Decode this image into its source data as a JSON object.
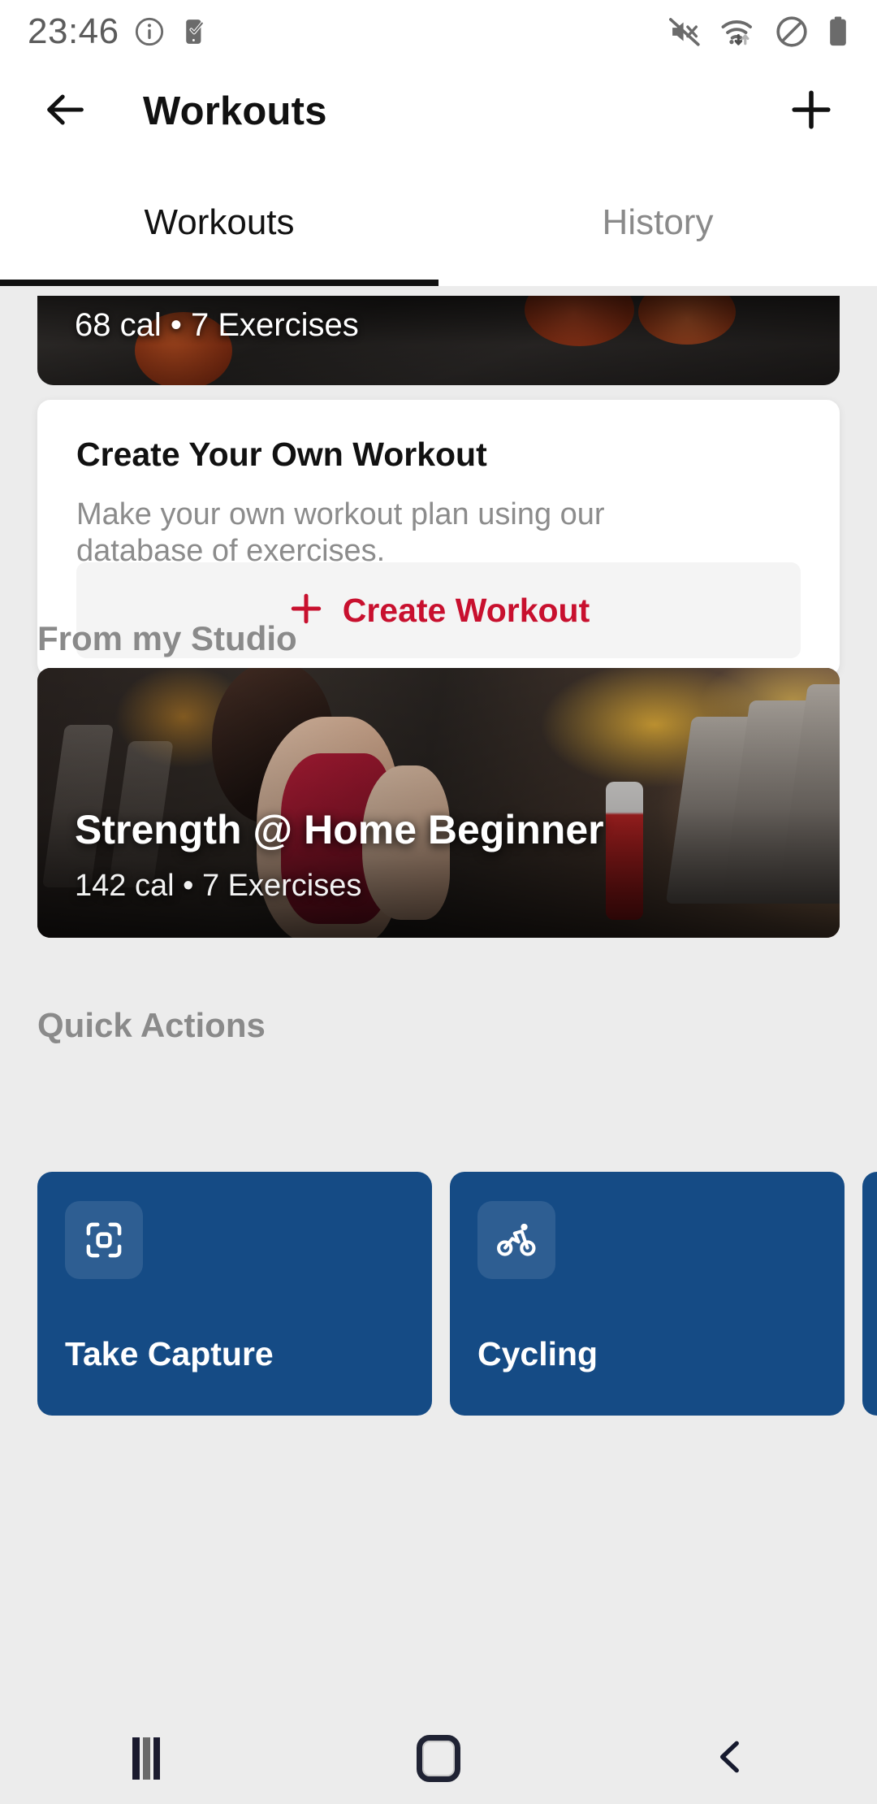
{
  "status_bar": {
    "time": "23:46",
    "left_icons": [
      "info-icon",
      "phone-check-icon"
    ],
    "right_icons": [
      "mute-icon",
      "wifi-icon",
      "do-not-disturb-icon",
      "battery-icon"
    ]
  },
  "app_bar": {
    "back_icon": "arrow-left-icon",
    "title": "Workouts",
    "add_icon": "plus-icon"
  },
  "tabs": [
    {
      "label": "Workouts",
      "active": true
    },
    {
      "label": "History",
      "active": false
    }
  ],
  "partial_card": {
    "meta": "68 cal • 7 Exercises"
  },
  "create_card": {
    "title": "Create Your Own Workout",
    "subtitle": "Make your own workout plan using our database of exercises.",
    "button_label": "Create Workout",
    "button_icon": "plus-icon"
  },
  "studio_section": {
    "heading": "From my Studio",
    "card": {
      "title": "Strength @ Home Beginner",
      "meta": "142 cal • 7 Exercises"
    }
  },
  "quick_actions": {
    "heading": "Quick Actions",
    "items": [
      {
        "label": "Take Capture",
        "icon": "scan-frame-icon"
      },
      {
        "label": "Cycling",
        "icon": "bicycle-icon"
      },
      {
        "label": "",
        "icon": ""
      }
    ]
  },
  "nav_bar": {
    "recents_icon": "recents-icon",
    "home_icon": "home-icon",
    "back_icon": "chevron-left-icon"
  },
  "colors": {
    "accent_red": "#C8102E",
    "quick_action_blue": "#154B85",
    "background_gray": "#ECECEC",
    "card_white": "#FFFFFF",
    "muted_text": "#8A8A8A"
  }
}
